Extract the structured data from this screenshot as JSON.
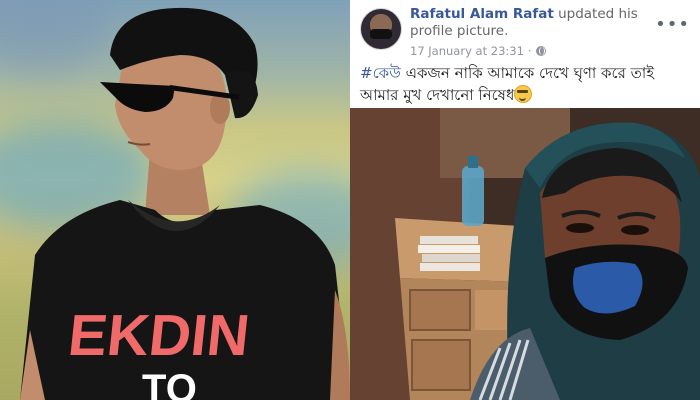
{
  "left_photo": {
    "shirt_text_line1": "EKDIN",
    "shirt_text_line2": "TO"
  },
  "post": {
    "author_name": "Rafatul Alam Rafat",
    "action_text": " updated his profile picture.",
    "timestamp": "17 January at 23:31",
    "separator": " · ",
    "privacy_icon": "globe-icon",
    "more_icon": "more-options-icon",
    "hashtag": "#কেউ",
    "body_text": " একজন নাকি আমাকে দেখে ঘৃণা করে তাই আমার মুখ দেখানো নিষেধ",
    "emoji": "sunglasses-smile-icon"
  },
  "colors": {
    "link": "#385898",
    "meta": "#90949c",
    "text": "#1c1e21",
    "shirt_text": "#f06a6a"
  }
}
